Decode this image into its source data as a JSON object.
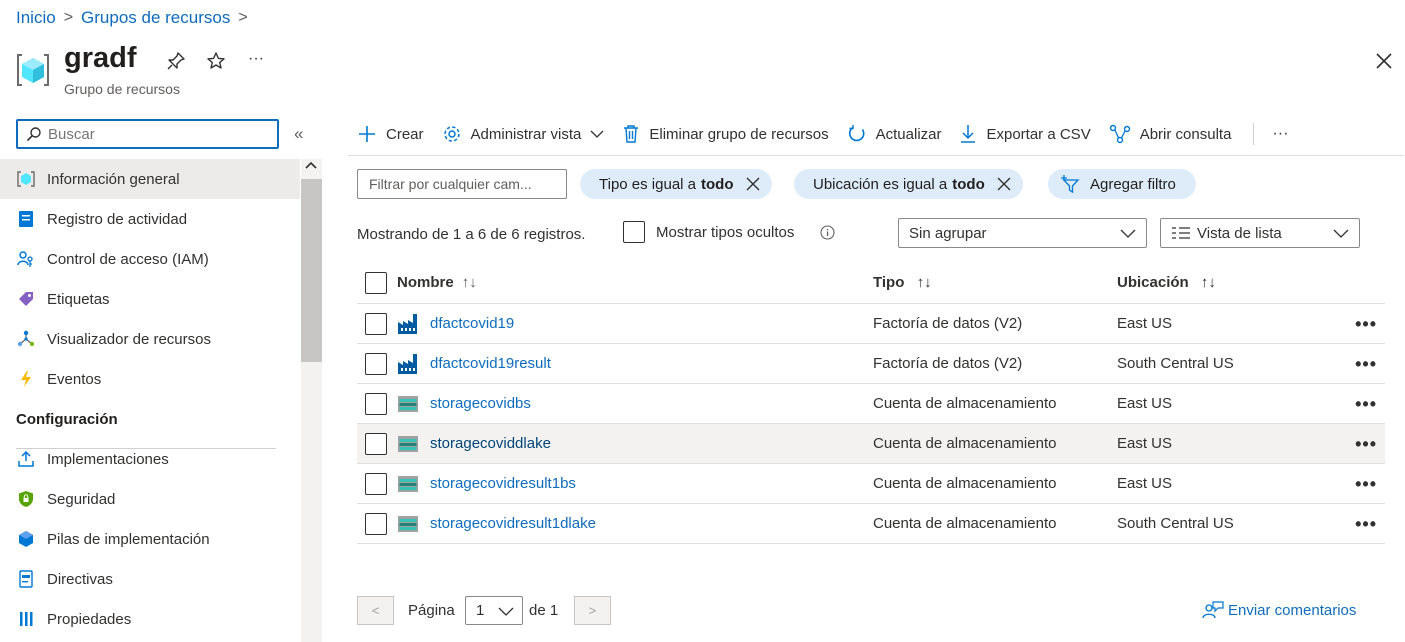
{
  "breadcrumb": {
    "items": [
      "Inicio",
      "Grupos de recursos"
    ],
    "separator": ">"
  },
  "header": {
    "title": "gradf",
    "subtitle": "Grupo de recursos",
    "more": "···"
  },
  "sidebar": {
    "search_placeholder": "Buscar",
    "collapse": "«",
    "items": [
      {
        "label": "Información general",
        "icon": "resource-group-icon",
        "active": true
      },
      {
        "label": "Registro de actividad",
        "icon": "activity-log-icon"
      },
      {
        "label": "Control de acceso (IAM)",
        "icon": "iam-icon"
      },
      {
        "label": "Etiquetas",
        "icon": "tag-icon"
      },
      {
        "label": "Visualizador de recursos",
        "icon": "resource-visualizer-icon"
      },
      {
        "label": "Eventos",
        "icon": "lightning-icon"
      }
    ],
    "section": "Configuración",
    "config_items": [
      {
        "label": "Implementaciones",
        "icon": "deployments-icon"
      },
      {
        "label": "Seguridad",
        "icon": "shield-icon"
      },
      {
        "label": "Pilas de implementación",
        "icon": "deployment-stacks-icon"
      },
      {
        "label": "Directivas",
        "icon": "policy-icon"
      },
      {
        "label": "Propiedades",
        "icon": "properties-icon"
      }
    ]
  },
  "toolbar": {
    "create": "Crear",
    "manage_view": "Administrar vista",
    "delete": "Eliminar grupo de recursos",
    "refresh": "Actualizar",
    "export": "Exportar a CSV",
    "open_query": "Abrir consulta",
    "more": "···"
  },
  "filters": {
    "placeholder": "Filtrar por cualquier cam...",
    "type_prefix": "Tipo es igual a",
    "type_value": "todo",
    "location_prefix": "Ubicación es igual a",
    "location_value": "todo",
    "add_filter": "Agregar filtro"
  },
  "list_info": {
    "showing": "Mostrando de 1 a 6 de 6 registros.",
    "show_hidden": "Mostrar tipos ocultos",
    "grouping": "Sin agrupar",
    "view_mode": "Vista de lista"
  },
  "table": {
    "columns": [
      "Nombre",
      "Tipo",
      "Ubicación"
    ],
    "rows": [
      {
        "name": "dfactcovid19",
        "type": "Factoría de datos (V2)",
        "location": "East US",
        "icon": "data-factory-icon"
      },
      {
        "name": "dfactcovid19result",
        "type": "Factoría de datos (V2)",
        "location": "South Central US",
        "icon": "data-factory-icon"
      },
      {
        "name": "storagecovidbs",
        "type": "Cuenta de almacenamiento",
        "location": "East US",
        "icon": "storage-account-icon"
      },
      {
        "name": "storagecoviddlake",
        "type": "Cuenta de almacenamiento",
        "location": "East US",
        "icon": "storage-account-icon",
        "hover": true
      },
      {
        "name": "storagecovidresult1bs",
        "type": "Cuenta de almacenamiento",
        "location": "East US",
        "icon": "storage-account-icon"
      },
      {
        "name": "storagecovidresult1dlake",
        "type": "Cuenta de almacenamiento",
        "location": "South Central US",
        "icon": "storage-account-icon"
      }
    ],
    "row_more": "•••"
  },
  "pagination": {
    "prev": "<",
    "label": "Página",
    "current": "1",
    "of": "de 1",
    "next": ">"
  },
  "feedback": "Enviar comentarios",
  "colors": {
    "accent": "#0f6cbd",
    "pill_bg": "#deecf9",
    "active_bg": "#edebe9"
  }
}
